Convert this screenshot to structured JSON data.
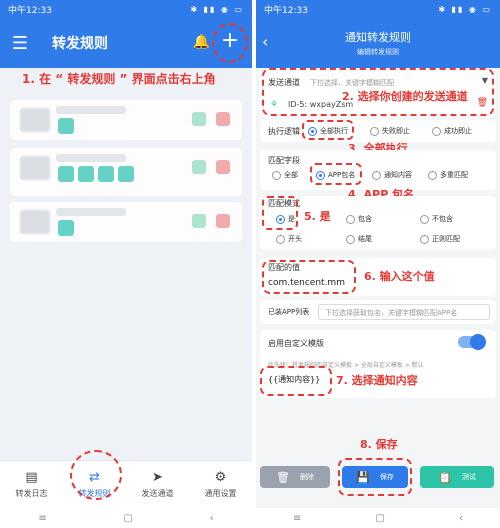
{
  "left": {
    "status": {
      "time": "中午12:33",
      "icons": "✱ ▮▮ ◉ ▭"
    },
    "title": "转发规则",
    "icons": {
      "menu": "☰",
      "bell": "🔔",
      "plus": "+"
    },
    "annotation": "1. 在 “ 转发规则 ” 界面点击右上角",
    "nav": [
      {
        "label": "转发日志",
        "icon": "▤"
      },
      {
        "label": "转发规则",
        "icon": "⇄"
      },
      {
        "label": "发送通道",
        "icon": "➤"
      },
      {
        "label": "通用设置",
        "icon": "⚙"
      }
    ],
    "sys": [
      "≡",
      "▢",
      "‹"
    ]
  },
  "right": {
    "status": {
      "time": "中午12:33",
      "icons": "✱ ▮▮ ◉ ▭"
    },
    "title": "通知转发规则",
    "subtitle": "编辑转发规则",
    "back": "‹",
    "send_channel": {
      "label": "发送通道",
      "placeholder": "下拉选择，关键字模糊匹配",
      "selected": "ID-5: wxpayZsm",
      "annotation": "2. 选择你创建的发送通道"
    },
    "exec_logic": {
      "label": "执行逻辑",
      "options": [
        "全部执行",
        "失败即止",
        "成功即止"
      ],
      "annotation": "3. 全部执行"
    },
    "match_field": {
      "label": "匹配字段",
      "options": [
        "全部",
        "APP包名",
        "通知内容",
        "多重匹配"
      ],
      "annotation": "4. APP 包名"
    },
    "match_mode": {
      "label": "匹配模式",
      "options_row1": [
        "是",
        "包含",
        "不包含"
      ],
      "options_row2": [
        "开头",
        "结尾",
        "正则匹配"
      ],
      "annotation": "5. 是"
    },
    "match_value": {
      "label": "匹配的值",
      "value": "com.tencent.mm",
      "annotation": "6. 输入这个值"
    },
    "app_list": {
      "label": "已装APP列表",
      "placeholder": "下拉选择获取包名，关键字模糊匹配APP名"
    },
    "custom_template": {
      "label": "启用自定义模版",
      "hint": "优先级：转发规则的自定义模板 > 全局自定义模板 > 默认",
      "value": "{{通知内容}}",
      "annotation": "7. 选择通知内容"
    },
    "buttons": {
      "delete": "删除",
      "save": "保存",
      "test": "测试"
    },
    "save_annotation": "8. 保存",
    "sys": [
      "≡",
      "▢",
      "‹"
    ]
  },
  "colors": {
    "primary": "#2f7bea",
    "annotation": "#e53935",
    "delete": "#9aa3ad",
    "save": "#2f7bea",
    "test": "#2dc3a6"
  }
}
